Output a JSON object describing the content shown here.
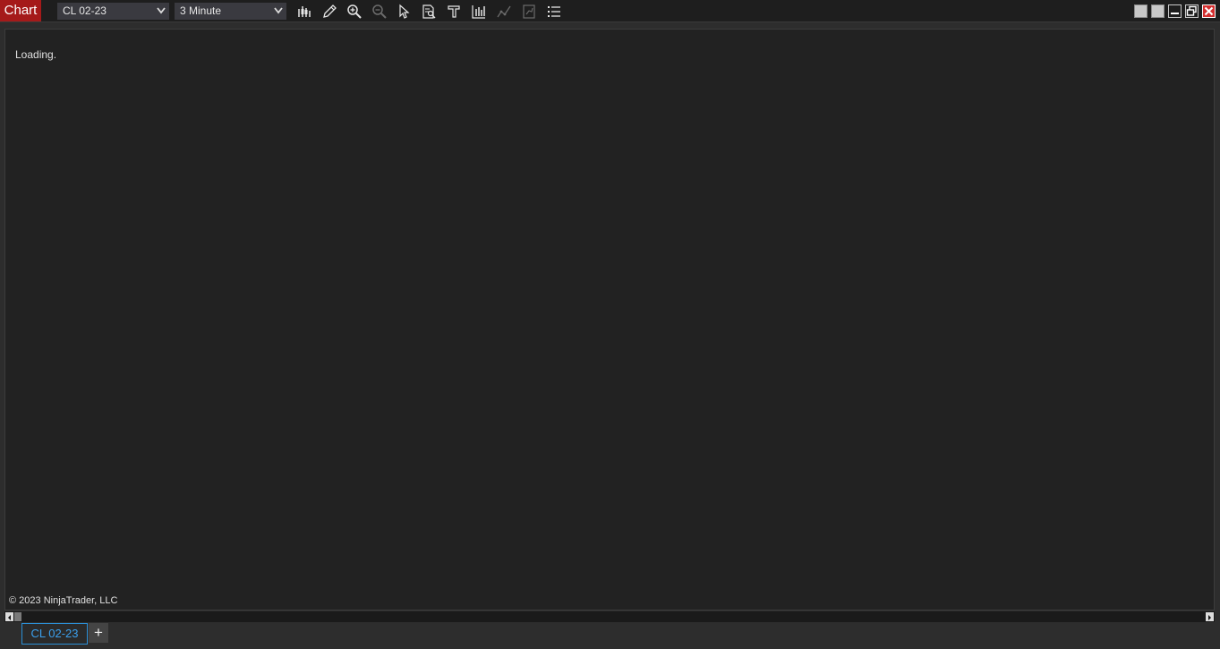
{
  "title": "Chart",
  "toolbar": {
    "instrument": "CL 02-23",
    "interval": "3 Minute",
    "icons": [
      "bar-type-icon",
      "drawing-tool-icon",
      "zoom-in-icon",
      "zoom-out-icon",
      "pointer-icon",
      "data-box-icon",
      "properties-icon",
      "indicators-icon",
      "strategies-icon",
      "chart-trader-icon",
      "menu-list-icon"
    ]
  },
  "chart": {
    "status": "Loading.",
    "copyright": "© 2023 NinjaTrader, LLC"
  },
  "tabs": [
    {
      "label": "CL 02-23",
      "active": true
    }
  ],
  "add_tab_label": "+",
  "colors": {
    "title_bg": "#a51a1a",
    "chart_bg": "#222222",
    "tab_accent": "#2b8fd6",
    "close_button": "#d32f2f"
  }
}
